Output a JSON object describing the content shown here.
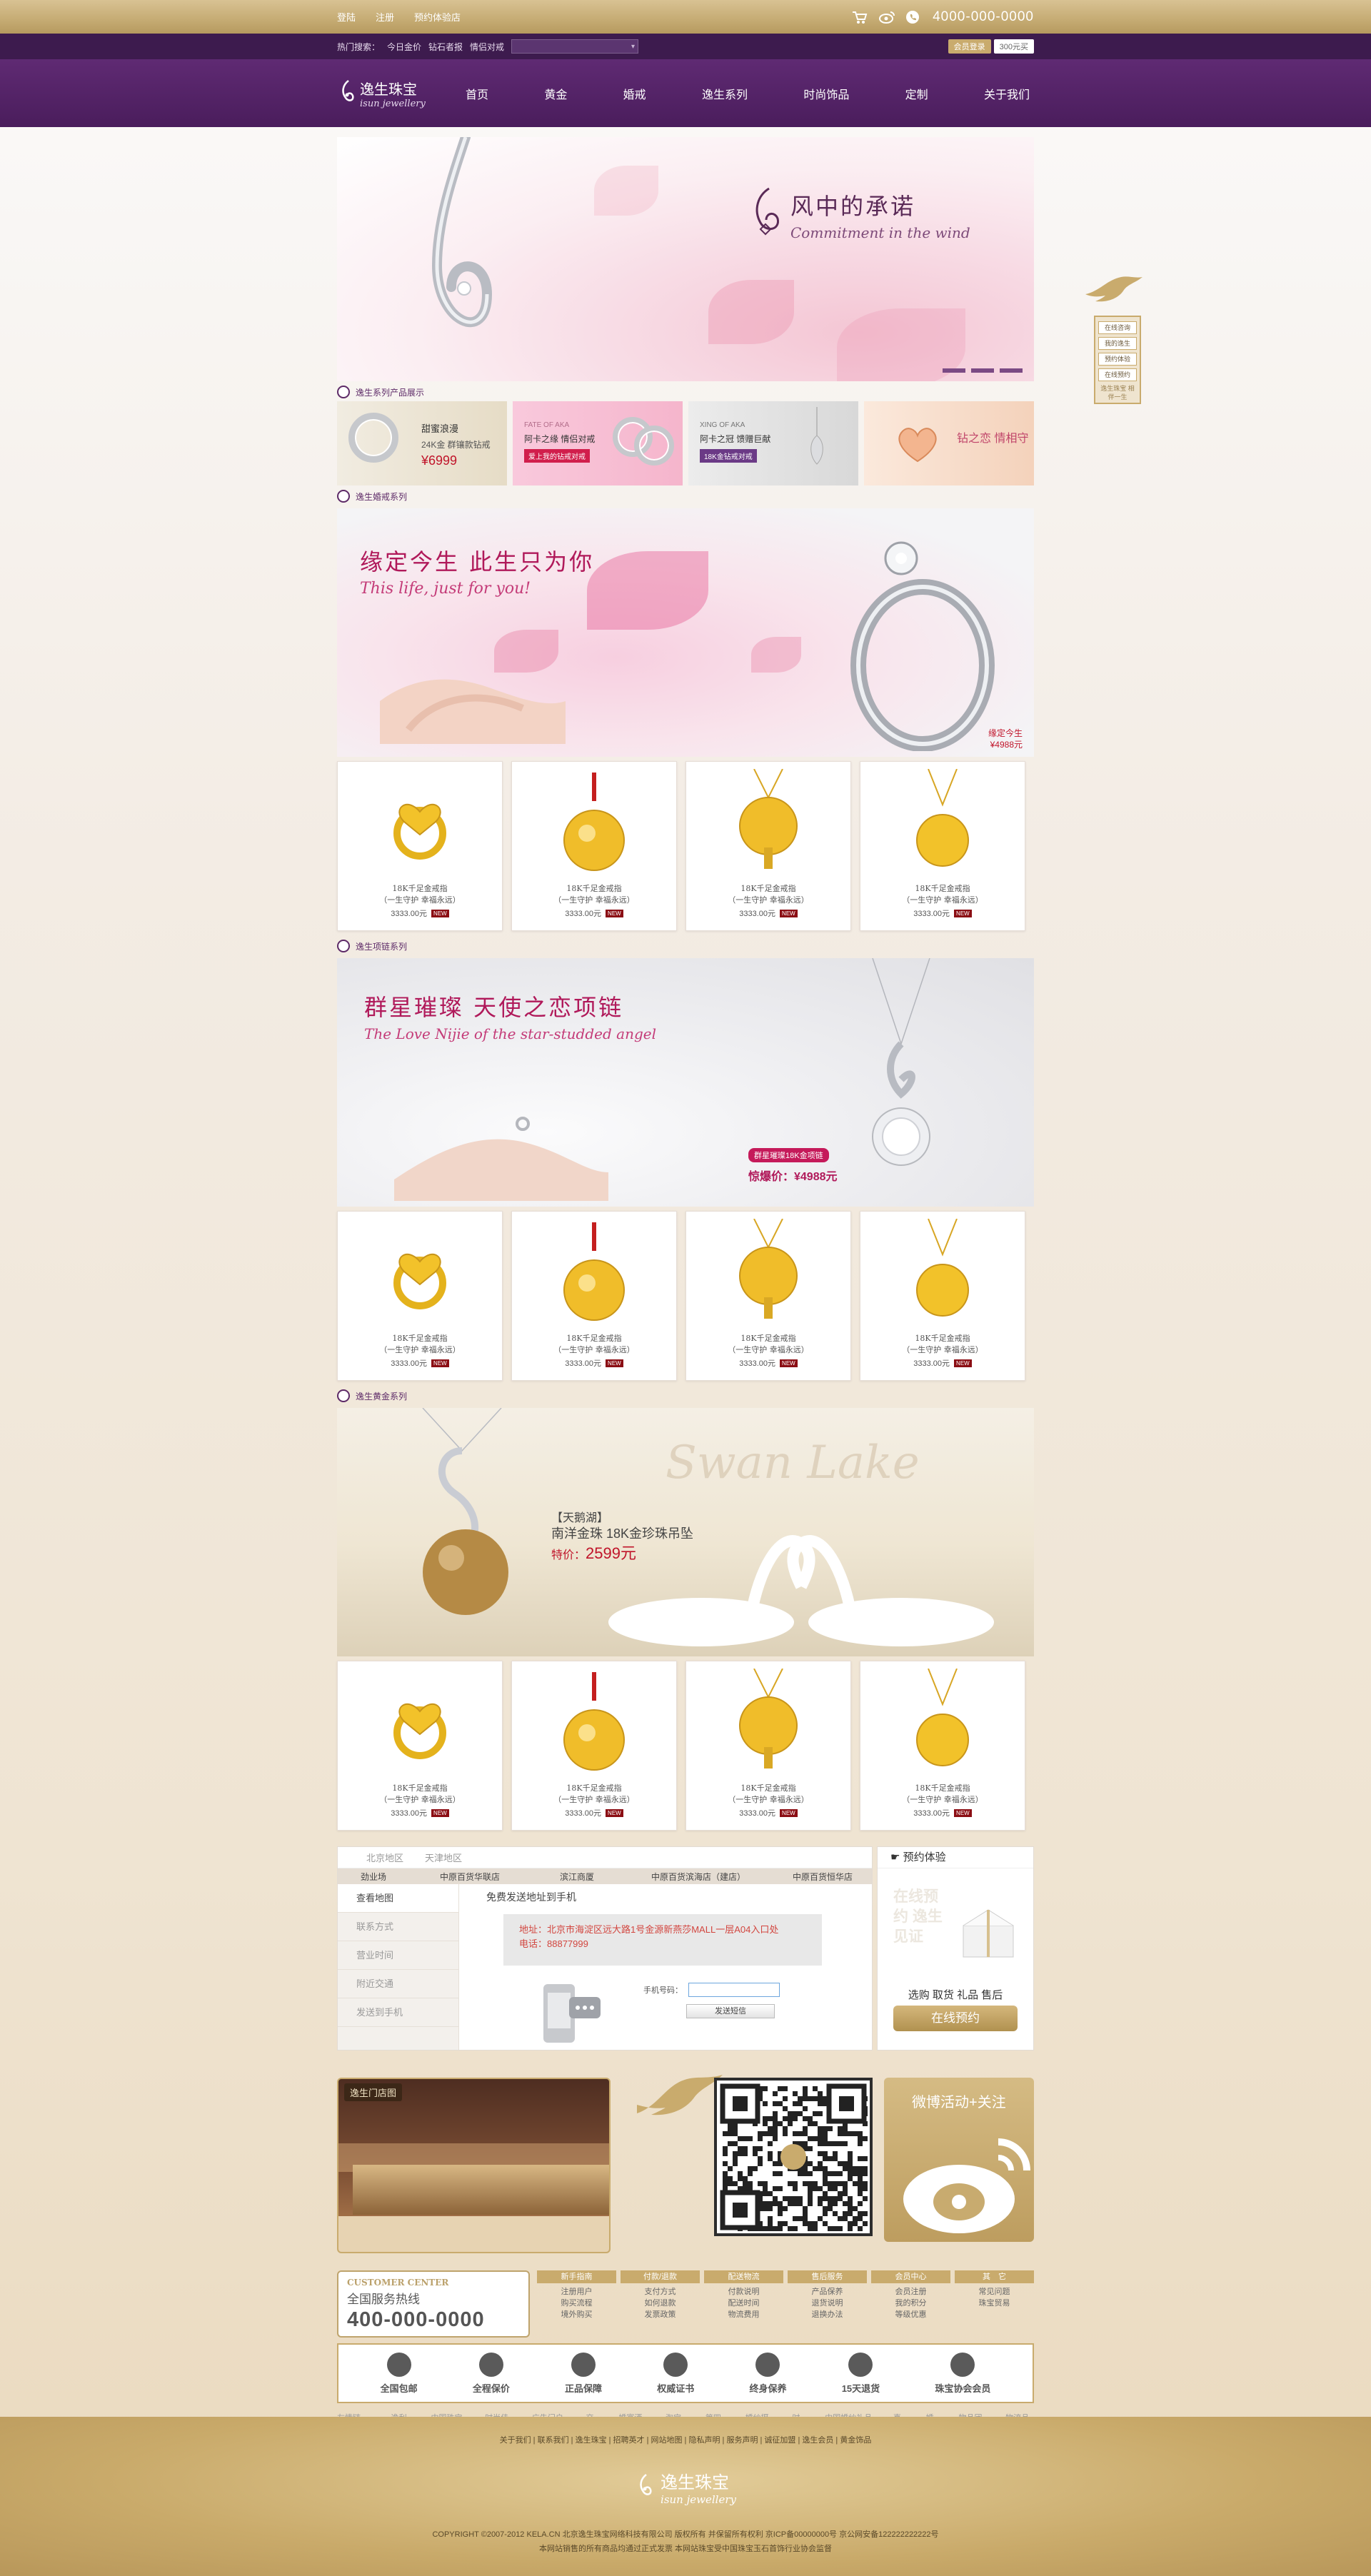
{
  "topbar": {
    "links": [
      "登陆",
      "注册",
      "预约体验店"
    ],
    "phone": "4000-000-0000"
  },
  "searchbar": {
    "hot_label": "热门搜索：",
    "hot_terms": [
      "今日金价",
      "钻石者报",
      "情侣对戒"
    ],
    "mini": [
      "会员登录",
      "300元买"
    ]
  },
  "nav": {
    "logo_cn": "逸生珠宝",
    "logo_en": "isun jewellery",
    "items": [
      "首页",
      "黄金",
      "婚戒",
      "逸生系列",
      "时尚饰品",
      "定制",
      "关于我们"
    ]
  },
  "hero": {
    "title": "风中的承诺",
    "subtitle": "Commitment in the wind"
  },
  "sections": {
    "s1": "逸生系列产品展示",
    "s2": "逸生婚戒系列",
    "s3": "逸生项链系列",
    "s4": "逸生黄金系列"
  },
  "promos": [
    {
      "l1": "甜蜜浪漫",
      "l2": "24K金 群镶款钻戒",
      "price": "¥6999",
      "tag": ""
    },
    {
      "l1": "FATE OF AKA",
      "l2": "阿卡之缘 情侣对戒",
      "price": "",
      "tag": "爱上我的钻戒对戒"
    },
    {
      "l1": "XING OF AKA",
      "l2": "阿卡之冠 馈赠巨献",
      "price": "",
      "tag": "18K金钻戒对戒"
    },
    {
      "l1": "钻之恋 情相守",
      "l2": "",
      "price": "",
      "tag": ""
    }
  ],
  "banner_ring": {
    "title": "缘定今生  此生只为你",
    "subtitle": "This life, just for you!",
    "tag1": "缘定今生",
    "tag2": "¥4988元"
  },
  "banner_necklace": {
    "title": "群星璀璨  天使之恋项链",
    "subtitle": "The Love Nijie of the star-studded angel",
    "tag": "群星璀璨18K金项链",
    "price": "惊爆价：¥4988元"
  },
  "banner_swan": {
    "script": "Swan Lake",
    "l1": "【天鹅湖】",
    "l2": "南洋金珠 18K金珍珠吊坠",
    "price_label": "特价：",
    "price": "2599元"
  },
  "product": {
    "name1": "18K千足金戒指",
    "name2": "（一生守护 幸福永远）",
    "price": "3333.00元",
    "new": "NEW"
  },
  "store": {
    "tabs": [
      "北京地区",
      "天津地区"
    ],
    "cols": [
      "劲业场",
      "中原百货华联店",
      "滨江商厦",
      "中原百货滨海店（建店）",
      "中原百货恒华店"
    ],
    "menu": [
      "查看地图",
      "联系方式",
      "营业时间",
      "附近交通",
      "发送到手机"
    ],
    "send_title": "免费发送地址到手机",
    "address": "地址：北京市海淀区远大路1号金源新燕莎MALL一层A04入口处",
    "tel": "电话：88877999",
    "phone_label": "手机号码：",
    "send_btn": "发送短信",
    "right_title": "预约体验",
    "right_sub": "选购 取货 礼品 售后",
    "right_btn": "在线预约",
    "stamp": "在线预约 逸生见证"
  },
  "feature": {
    "store_label": "逸生门店图",
    "weibo_title": "微博活动+关注"
  },
  "service": {
    "cc_en": "CUSTOMER CENTER",
    "cc_cn": "全国服务热线",
    "cc_phone": "400-000-0000",
    "cols": [
      {
        "h": "新手指南",
        "items": [
          "注册用户",
          "购买流程",
          "境外购买"
        ]
      },
      {
        "h": "付款/退款",
        "items": [
          "支付方式",
          "如何退款",
          "发票政策"
        ]
      },
      {
        "h": "配送物流",
        "items": [
          "付款说明",
          "配送时间",
          "物流费用"
        ]
      },
      {
        "h": "售后服务",
        "items": [
          "产品保养",
          "退货说明",
          "退换办法"
        ]
      },
      {
        "h": "会员中心",
        "items": [
          "会员注册",
          "我的积分",
          "等级优惠"
        ]
      },
      {
        "h": "其　它",
        "items": [
          "常见问题",
          "珠宝贸易"
        ]
      }
    ],
    "guarantees": [
      "全国包邮",
      "全程保价",
      "正品保障",
      "权威证书",
      "终身保养",
      "15天退货",
      "珠宝协会会员"
    ]
  },
  "links": [
    "友情链接：",
    "逸利网",
    "中国珠宝网",
    "时尚佳网",
    "广告门户网",
    "交友",
    "婚宴酒店",
    "淘宝网",
    "第四城",
    "婚纱摄影",
    "时尚",
    "中国婚纱礼品网",
    "喜宴",
    "婚礼",
    "物品团购",
    "物流品牌"
  ],
  "footer": {
    "nav": "关于我们 | 联系我们 | 逸生珠宝 | 招聘英才 | 网站地图 | 隐私声明 | 服务声明 | 诚征加盟 | 逸生会员 | 黄金饰品",
    "logo_cn": "逸生珠宝",
    "logo_en": "isun jewellery",
    "copy1": "COPYRIGHT ©2007-2012 KELA.CN 北京逸生珠宝网络科技有限公司 版权所有 并保留所有权利  京ICP备00000000号 京公网安备122222222222号",
    "copy2": "本网站销售的所有商品均通过正式发票  本网站珠宝受中国珠宝玉石首饰行业协会监督"
  },
  "floater": {
    "btns": [
      "在线咨询",
      "我的逸生",
      "预约体验",
      "在线预约"
    ],
    "txt": "逸生珠宝 相伴一生"
  },
  "colors": {
    "purple": "#4a1d5c",
    "gold": "#c9ab6d",
    "red": "#c0142a"
  }
}
